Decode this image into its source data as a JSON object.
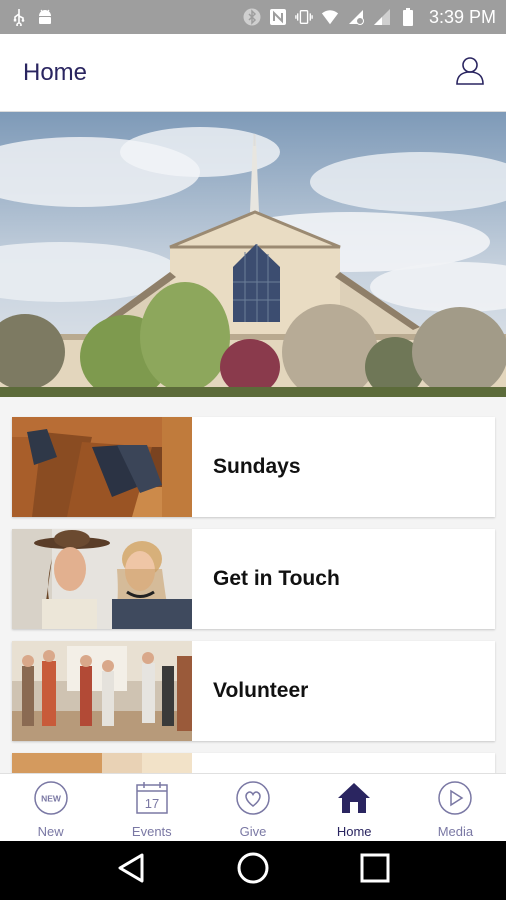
{
  "status_bar": {
    "time": "3:39 PM",
    "icons": [
      "usb-icon",
      "android-icon",
      "bluetooth-icon",
      "nfc-icon",
      "vibrate-icon",
      "wifi-icon",
      "signal-icon",
      "battery-icon"
    ]
  },
  "header": {
    "title": "Home",
    "profile_icon": "user-profile-icon"
  },
  "hero": {
    "image": "church-building-photo"
  },
  "cards": [
    {
      "label": "Sundays",
      "image": "church-pews-photo"
    },
    {
      "label": "Get in Touch",
      "image": "two-women-photo"
    },
    {
      "label": "Volunteer",
      "image": "church-lobby-photo"
    },
    {
      "label": "",
      "image": "partial-card-photo"
    }
  ],
  "bottom_nav": [
    {
      "label": "New",
      "icon": "new-badge-icon",
      "active": false
    },
    {
      "label": "Events",
      "icon": "calendar-icon",
      "calendar_day": "17",
      "active": false
    },
    {
      "label": "Give",
      "icon": "heart-icon",
      "active": false
    },
    {
      "label": "Home",
      "icon": "home-icon",
      "active": true
    },
    {
      "label": "Media",
      "icon": "play-icon",
      "active": false
    }
  ],
  "new_badge_text": "NEW",
  "colors": {
    "brand": "#2a2560",
    "nav_inactive": "#7a78a4",
    "status_bar": "#9e9e9e"
  }
}
